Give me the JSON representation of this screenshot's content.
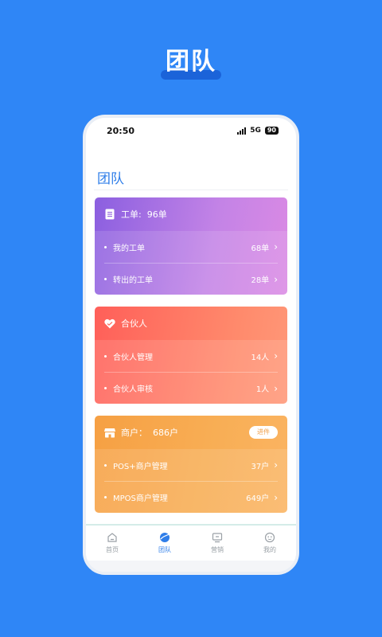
{
  "headline": "团队",
  "status_bar": {
    "time": "20:50",
    "network": "5G",
    "battery": "90"
  },
  "page_title": "团队",
  "cards": [
    {
      "header_label": "工单:",
      "header_value": "96单",
      "rows": [
        {
          "label": "我的工单",
          "value": "68单"
        },
        {
          "label": "转出的工单",
          "value": "28单"
        }
      ]
    },
    {
      "header_label": "合伙人",
      "rows": [
        {
          "label": "合伙人管理",
          "value": "14人"
        },
        {
          "label": "合伙人审核",
          "value": "1人"
        }
      ]
    },
    {
      "header_label": "商户：",
      "header_value": "686户",
      "action_label": "进件",
      "rows": [
        {
          "label": "POS+商户管理",
          "value": "37户"
        },
        {
          "label": "MPOS商户管理",
          "value": "649户"
        }
      ]
    }
  ],
  "tabs": [
    {
      "label": "首页",
      "icon": "home-icon"
    },
    {
      "label": "团队",
      "icon": "team-icon",
      "active": true
    },
    {
      "label": "营销",
      "icon": "marketing-icon"
    },
    {
      "label": "我的",
      "icon": "profile-icon"
    }
  ],
  "colors": {
    "background": "#2f86f6",
    "accent": "#2f7ee9",
    "card_purple": "#8b5fe0",
    "card_red": "#ff5f59",
    "card_orange": "#f6a043"
  }
}
